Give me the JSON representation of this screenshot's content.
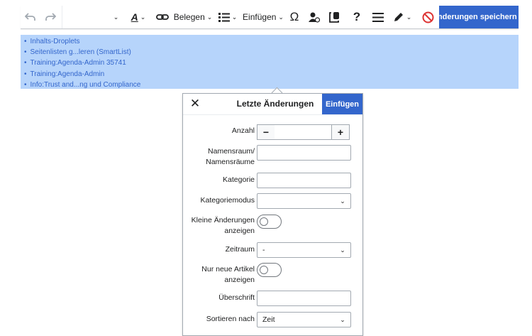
{
  "toolbar": {
    "undo_icon": "undo-icon",
    "redo_icon": "redo-icon",
    "format_icon": "text-format-icon",
    "link_icon": "link-icon",
    "cite_label": "Belegen",
    "list_icon": "bulleted-list-icon",
    "insert_label": "Einfügen",
    "special_char": "Ω",
    "help": "?",
    "save_label": "Änderungen speichern ...",
    "cancel_color": "#d33"
  },
  "selection": {
    "items": [
      "Inhalts-Droplets",
      "Seitenlisten g...leren (SmartList)",
      "Training:Agenda-Admin 35741",
      "Training:Agenda-Admin",
      "Info:Trust and...ng und Compliance"
    ]
  },
  "dialog": {
    "title": "Letzte Änderungen",
    "insert_label": "Einfügen",
    "fields": {
      "count_label": "Anzahl",
      "count_minus": "−",
      "count_plus": "+",
      "namespace_label": "Namensraum/ Namensräume",
      "category_label": "Kategorie",
      "category_mode_label": "Kategoriemodus",
      "category_mode_value": "",
      "minor_label": "Kleine Änderungen anzeigen",
      "period_label": "Zeitraum",
      "period_value": "-",
      "new_articles_label": "Nur neue Artikel anzeigen",
      "heading_label": "Überschrift",
      "sort_label": "Sortieren nach",
      "sort_value": "Zeit"
    }
  },
  "colors": {
    "accent": "#3366cc",
    "selection": "#b6d4fb",
    "link": "#3366cc"
  }
}
